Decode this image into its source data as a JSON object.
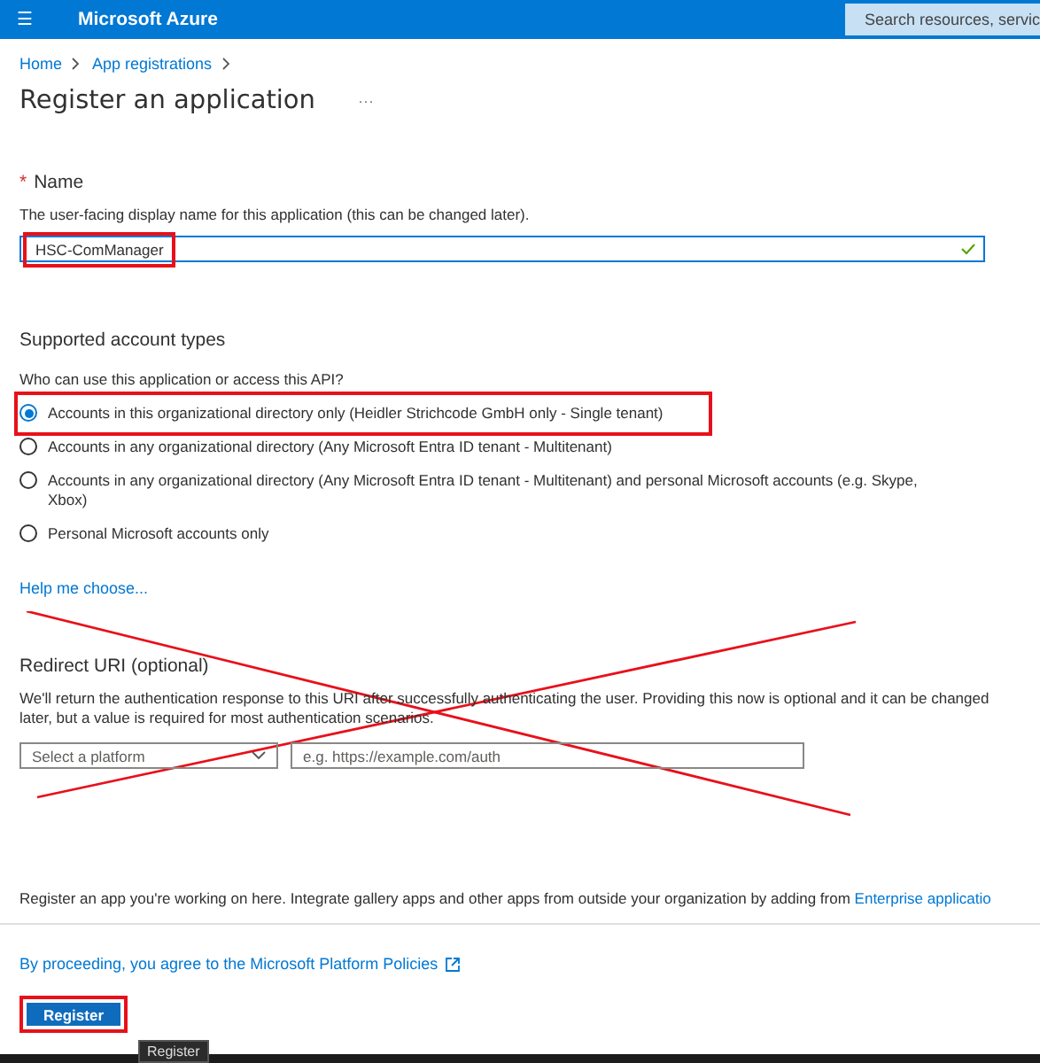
{
  "topbar": {
    "menu_icon": "☰",
    "title": "Microsoft Azure",
    "search_placeholder": "Search resources, servic"
  },
  "breadcrumb": [
    "Home",
    "App registrations"
  ],
  "page_title": "Register an application",
  "more": "···",
  "name_section": {
    "required_mark": "*",
    "label": "Name",
    "description": "The user-facing display name for this application (this can be changed later).",
    "value": "HSC-ComManager",
    "valid": true,
    "highlighted": true
  },
  "account_types": {
    "heading": "Supported account types",
    "question": "Who can use this application or access this API?",
    "options": [
      {
        "label": "Accounts in this organizational directory only (Heidler Strichcode GmbH only - Single tenant)",
        "selected": true,
        "highlighted": true
      },
      {
        "label": "Accounts in any organizational directory (Any Microsoft Entra ID tenant - Multitenant)",
        "selected": false,
        "highlighted": false
      },
      {
        "label": "Accounts in any organizational directory (Any Microsoft Entra ID tenant - Multitenant) and personal Microsoft accounts (e.g. Skype, Xbox)",
        "selected": false,
        "highlighted": false
      },
      {
        "label": "Personal Microsoft accounts only",
        "selected": false,
        "highlighted": false
      }
    ],
    "help_link": "Help me choose..."
  },
  "redirect": {
    "heading": "Redirect URI (optional)",
    "description": "We'll return the authentication response to this URI after successfully authenticating the user. Providing this now is optional and it can be changed later, but a value is required for most authentication scenarios.",
    "platform_placeholder": "Select a platform",
    "uri_placeholder": "e.g. https://example.com/auth",
    "crossed_out": true
  },
  "footer_note": {
    "text": "Register an app you're working on here. Integrate gallery apps and other apps from outside your organization by adding from ",
    "link": "Enterprise applicatio"
  },
  "policy_link": "By proceeding, you agree to the Microsoft Platform Policies",
  "register_button": {
    "label": "Register",
    "highlighted": true
  },
  "tooltip": "Register"
}
